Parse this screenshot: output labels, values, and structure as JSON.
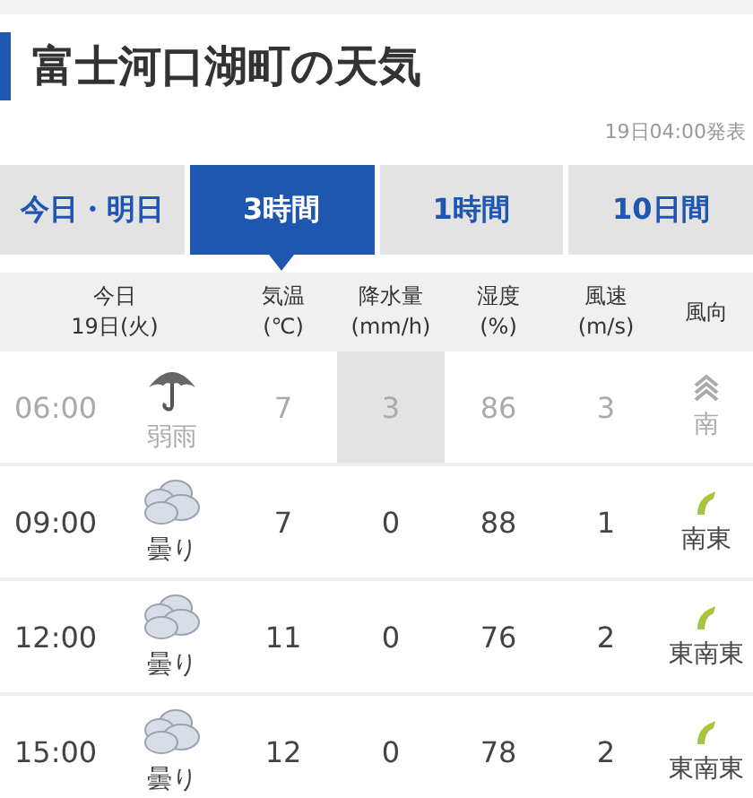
{
  "title": "富士河口湖町の天気",
  "published": "19日04:00発表",
  "tabs": [
    {
      "label": "今日・明日",
      "selected": false
    },
    {
      "label": "3時間",
      "selected": true
    },
    {
      "label": "1時間",
      "selected": false
    },
    {
      "label": "10日間",
      "selected": false
    }
  ],
  "table": {
    "columns": [
      [
        "今日",
        "19日(火)"
      ],
      [
        "気温",
        "(℃)"
      ],
      [
        "降水量",
        "(mm/h)"
      ],
      [
        "湿度",
        "(%)"
      ],
      [
        "風速",
        "(m/s)"
      ],
      [
        "風向"
      ]
    ],
    "rows": [
      {
        "time": "06:00",
        "kind": "rain",
        "weather": "弱雨",
        "temp": "7",
        "precip": "3",
        "precip_highlight": true,
        "humidity": "86",
        "wind_speed": "3",
        "wind_dir": "南",
        "past": true
      },
      {
        "time": "09:00",
        "kind": "cloudy",
        "weather": "曇り",
        "temp": "7",
        "precip": "0",
        "precip_highlight": false,
        "humidity": "88",
        "wind_speed": "1",
        "wind_dir": "南東",
        "past": false
      },
      {
        "time": "12:00",
        "kind": "cloudy",
        "weather": "曇り",
        "temp": "11",
        "precip": "0",
        "precip_highlight": false,
        "humidity": "76",
        "wind_speed": "2",
        "wind_dir": "東南東",
        "past": false
      },
      {
        "time": "15:00",
        "kind": "cloudy",
        "weather": "曇り",
        "temp": "12",
        "precip": "0",
        "precip_highlight": false,
        "humidity": "78",
        "wind_speed": "2",
        "wind_dir": "東南東",
        "past": false
      }
    ]
  }
}
